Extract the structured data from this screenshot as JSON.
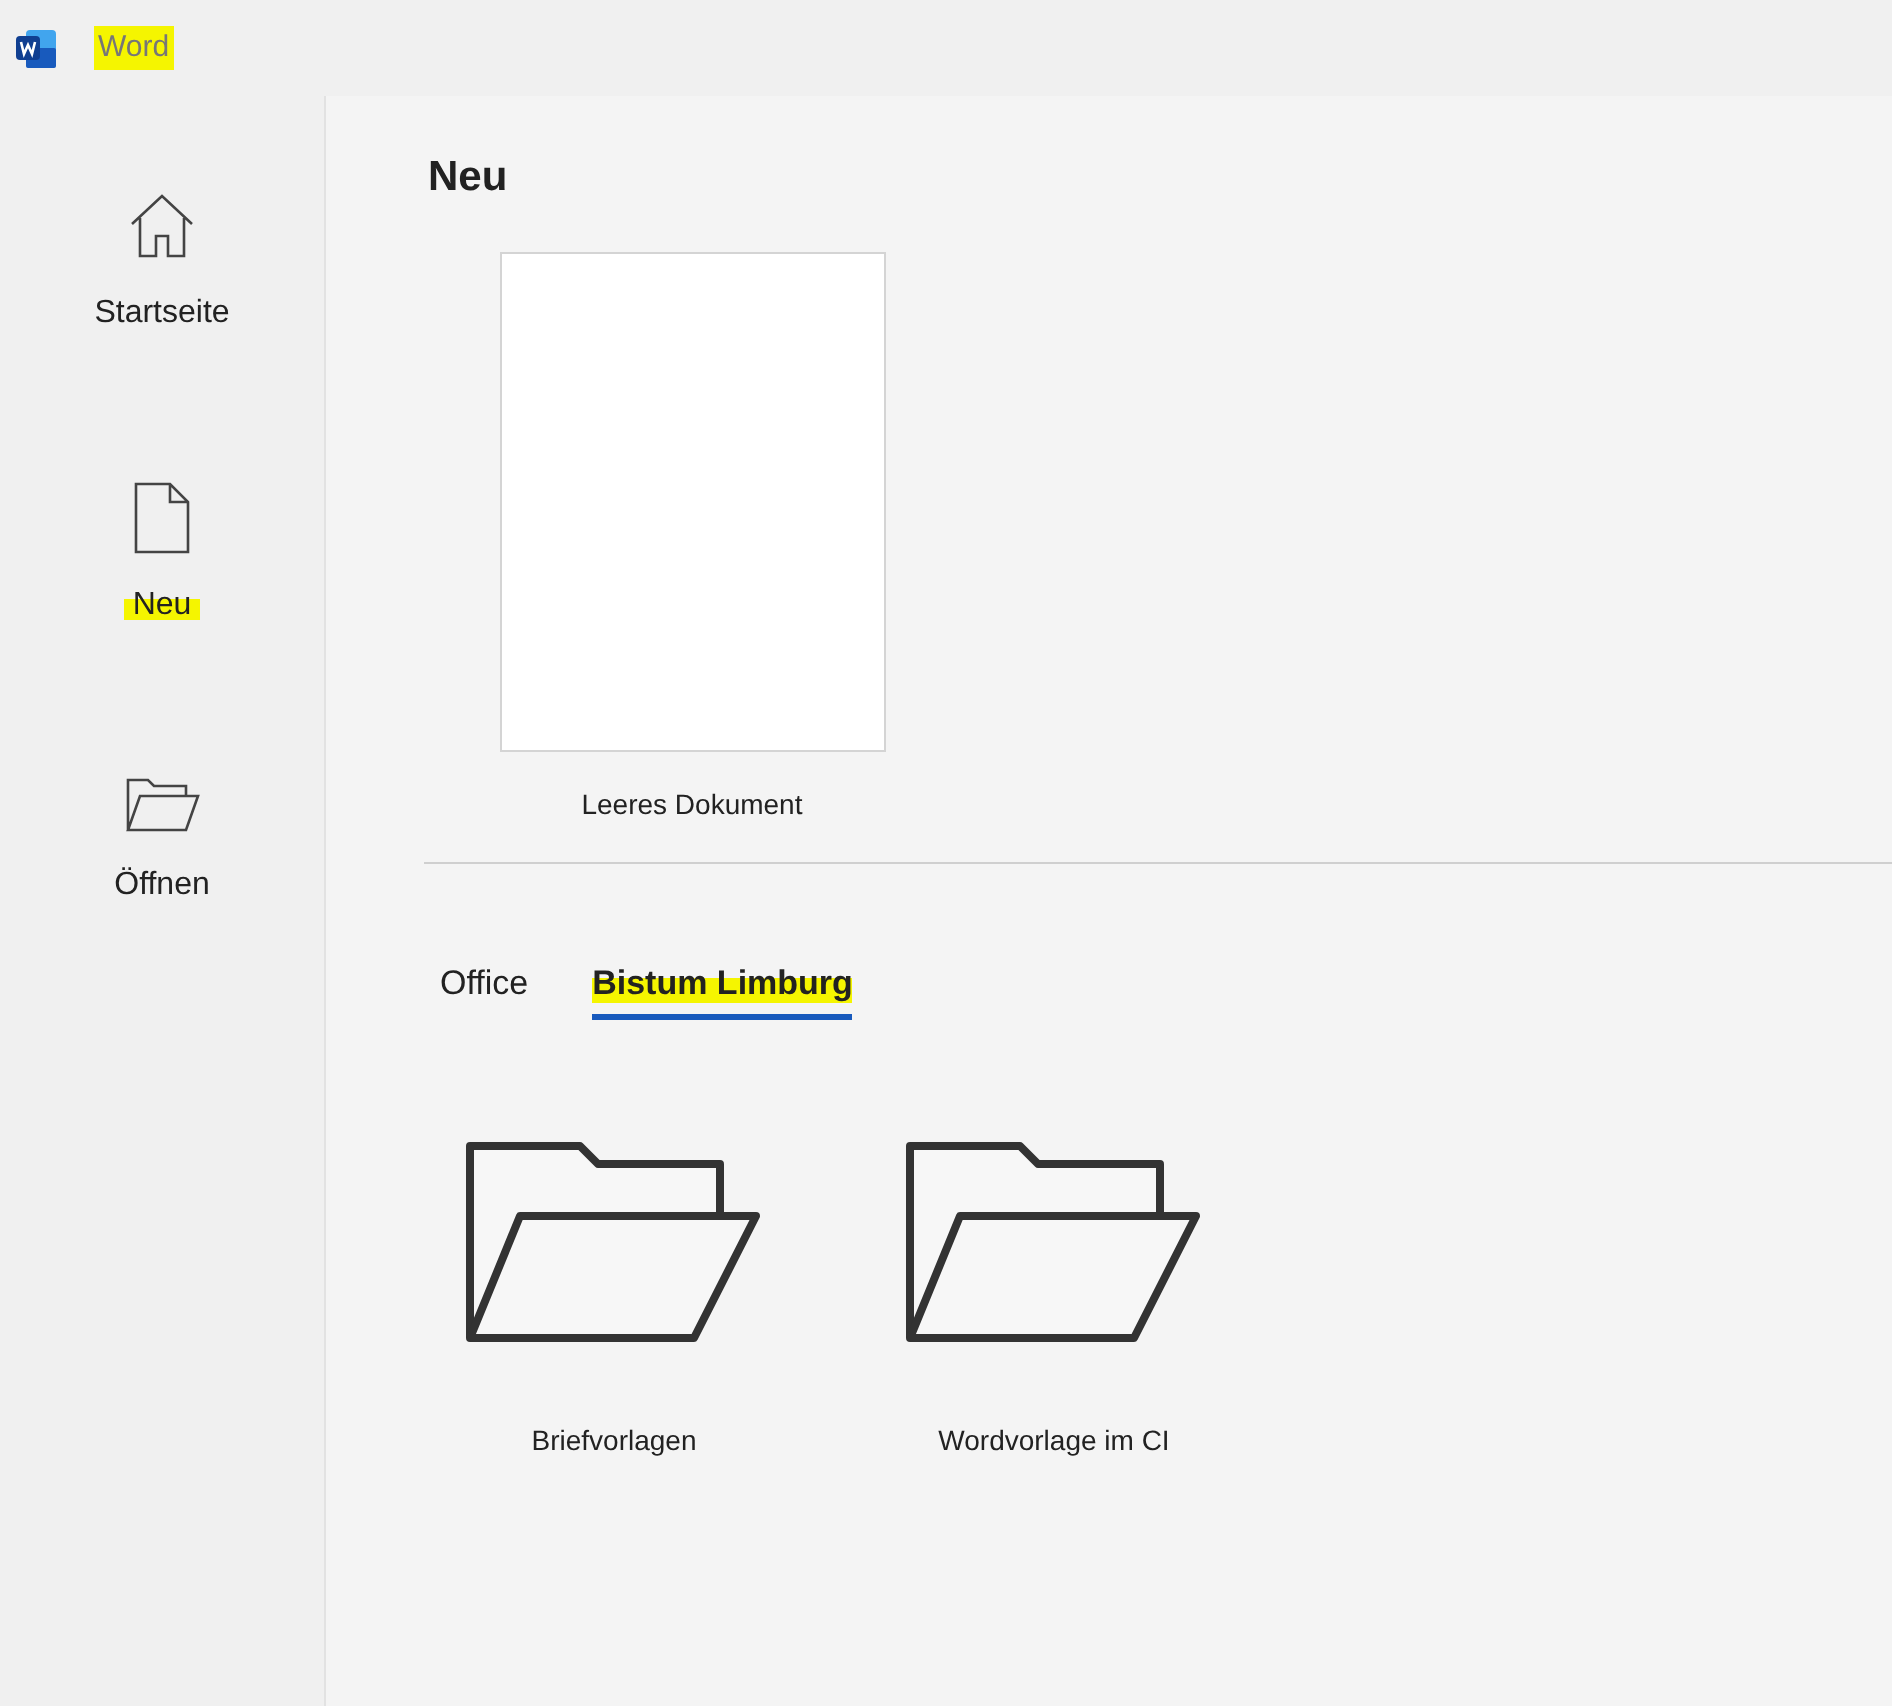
{
  "app": {
    "title": "Word",
    "highlighted": true
  },
  "sidebar": {
    "items": [
      {
        "kind": "home",
        "label": "Startseite",
        "highlighted": false
      },
      {
        "kind": "new",
        "label": "Neu",
        "highlighted": true
      },
      {
        "kind": "open",
        "label": "Öffnen",
        "highlighted": false
      }
    ]
  },
  "main": {
    "heading": "Neu",
    "blank_template": {
      "label": "Leeres Dokument"
    },
    "tabs": [
      {
        "label": "Office",
        "selected": false,
        "highlighted": false
      },
      {
        "label": "Bistum Limburg",
        "selected": true,
        "highlighted": true
      }
    ],
    "folders": [
      {
        "label": "Briefvorlagen"
      },
      {
        "label": "Wordvorlage im CI"
      }
    ]
  }
}
